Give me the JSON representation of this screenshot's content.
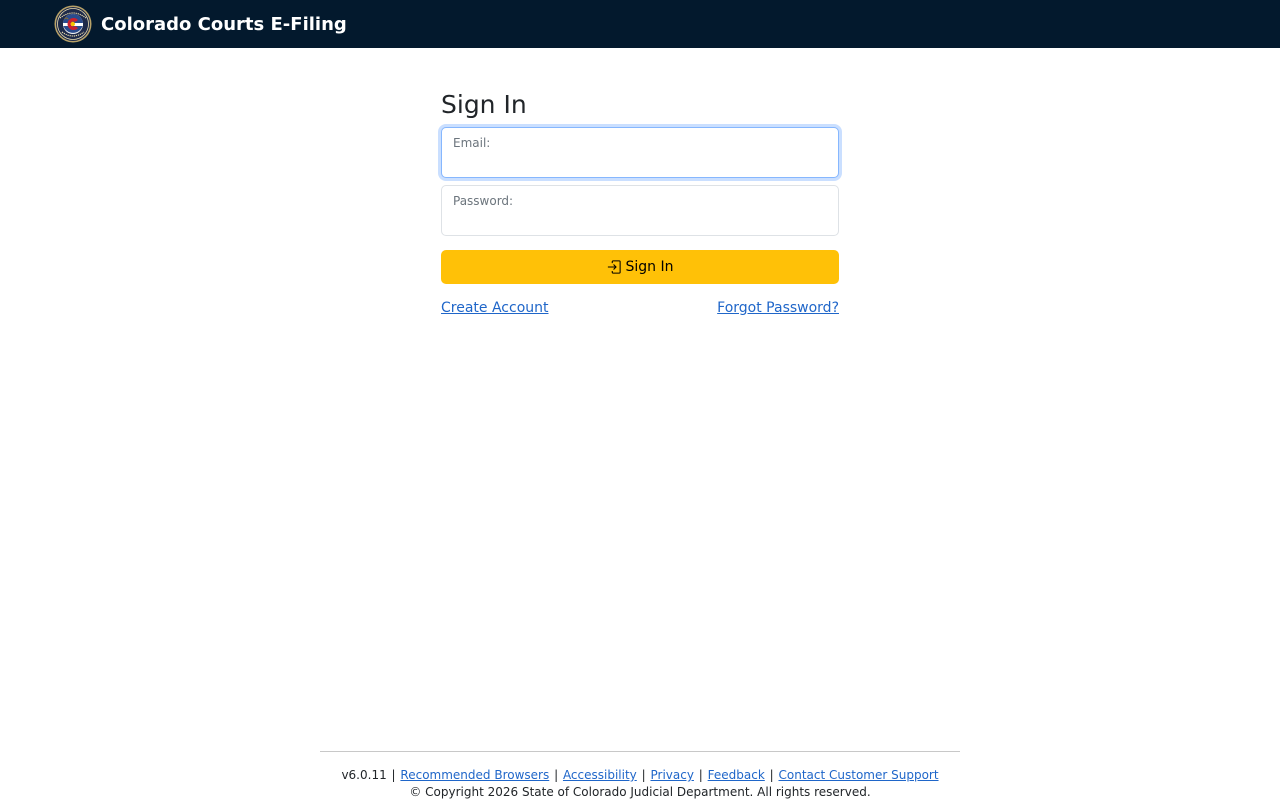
{
  "header": {
    "title": "Colorado Courts E-Filing",
    "logo_icon": "colorado-courts-seal-icon",
    "background_color": "#03192d"
  },
  "signin": {
    "heading": "Sign In",
    "email_label": "Email:",
    "email_value": "",
    "password_label": "Password:",
    "password_value": "",
    "button_label": "Sign In",
    "button_icon": "sign-in-icon",
    "button_color": "#ffc107",
    "create_account": "Create Account",
    "forgot_password": "Forgot Password?"
  },
  "footer": {
    "version": "v6.0.11",
    "separator": "|",
    "links": [
      "Recommended Browsers",
      "Accessibility",
      "Privacy",
      "Feedback",
      "Contact Customer Support"
    ],
    "copyright": "© Copyright 2026 State of Colorado Judicial Department. All rights reserved."
  }
}
